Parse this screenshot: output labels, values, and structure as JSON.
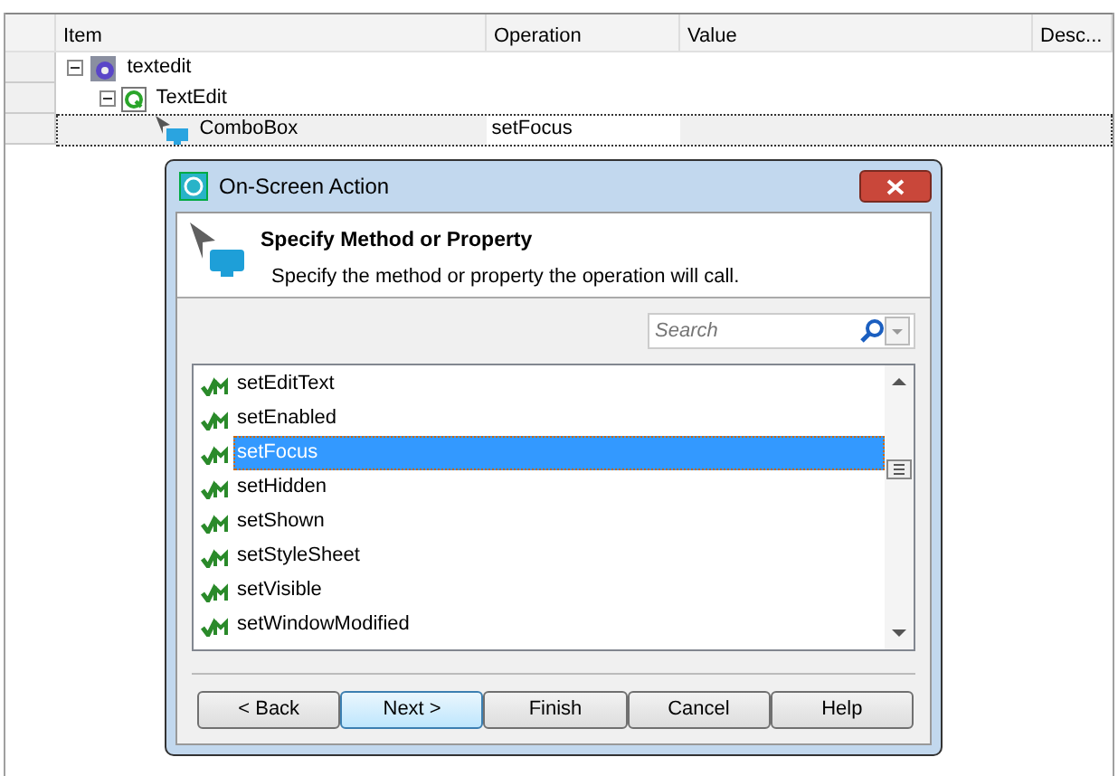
{
  "table": {
    "columns": [
      "Item",
      "Operation",
      "Value",
      "Desc..."
    ],
    "tree": [
      {
        "label": "textedit",
        "expanded": true,
        "children": [
          {
            "label": "TextEdit",
            "expanded": true,
            "children": [
              {
                "label": "ComboBox",
                "operation": "setFocus",
                "selected": true
              }
            ]
          }
        ]
      }
    ]
  },
  "dialog": {
    "title": "On-Screen Action",
    "heading": "Specify Method or Property",
    "subheading": "Specify the method or property the operation will call.",
    "search": {
      "placeholder": "Search"
    },
    "methods": [
      {
        "label": "setEditText",
        "selected": false
      },
      {
        "label": "setEnabled",
        "selected": false
      },
      {
        "label": "setFocus",
        "selected": true
      },
      {
        "label": "setHidden",
        "selected": false
      },
      {
        "label": "setShown",
        "selected": false
      },
      {
        "label": "setStyleSheet",
        "selected": false
      },
      {
        "label": "setVisible",
        "selected": false
      },
      {
        "label": "setWindowModified",
        "selected": false
      }
    ],
    "buttons": [
      {
        "label": "< Back",
        "default": false
      },
      {
        "label": "Next >",
        "default": true
      },
      {
        "label": "Finish",
        "default": false
      },
      {
        "label": "Cancel",
        "default": false
      },
      {
        "label": "Help",
        "default": false
      }
    ]
  }
}
